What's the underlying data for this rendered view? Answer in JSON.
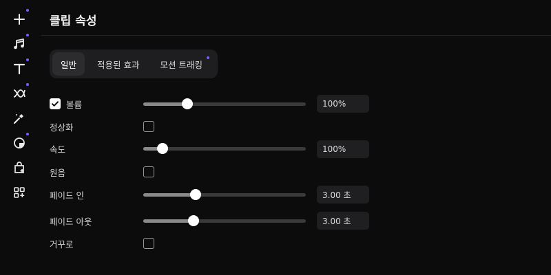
{
  "sidebar": {
    "items": [
      {
        "icon": "plus-icon",
        "dot": true
      },
      {
        "icon": "music-note-icon",
        "dot": true
      },
      {
        "icon": "text-t-icon",
        "dot": true
      },
      {
        "icon": "transition-icon",
        "dot": true
      },
      {
        "icon": "magic-wand-icon",
        "dot": false
      },
      {
        "icon": "sticker-icon",
        "dot": true
      },
      {
        "icon": "bag-add-icon",
        "dot": false
      },
      {
        "icon": "apps-add-icon",
        "dot": false
      }
    ],
    "accent": "#7a5cff"
  },
  "header": {
    "title": "클립 속성"
  },
  "tabs": [
    {
      "label": "일반",
      "active": true
    },
    {
      "label": "적용된 효과",
      "active": false
    },
    {
      "label": "모션 트래킹",
      "active": false,
      "dot": true
    }
  ],
  "properties": {
    "volume": {
      "label": "볼륨",
      "checked": true,
      "slider_level": 0.27,
      "value": "100%"
    },
    "normalize": {
      "label": "정상화",
      "checked": false
    },
    "speed": {
      "label": "속도",
      "slider_level": 0.12,
      "value": "100%"
    },
    "original_pitch": {
      "label": "원음",
      "checked": false
    },
    "fade_in": {
      "label": "페이드 인",
      "slider_level": 0.32,
      "value": "3.00 초"
    },
    "fade_out": {
      "label": "페이드 아웃",
      "slider_level": 0.31,
      "value": "3.00 초"
    },
    "reverse": {
      "label": "거꾸로",
      "checked": false
    }
  }
}
